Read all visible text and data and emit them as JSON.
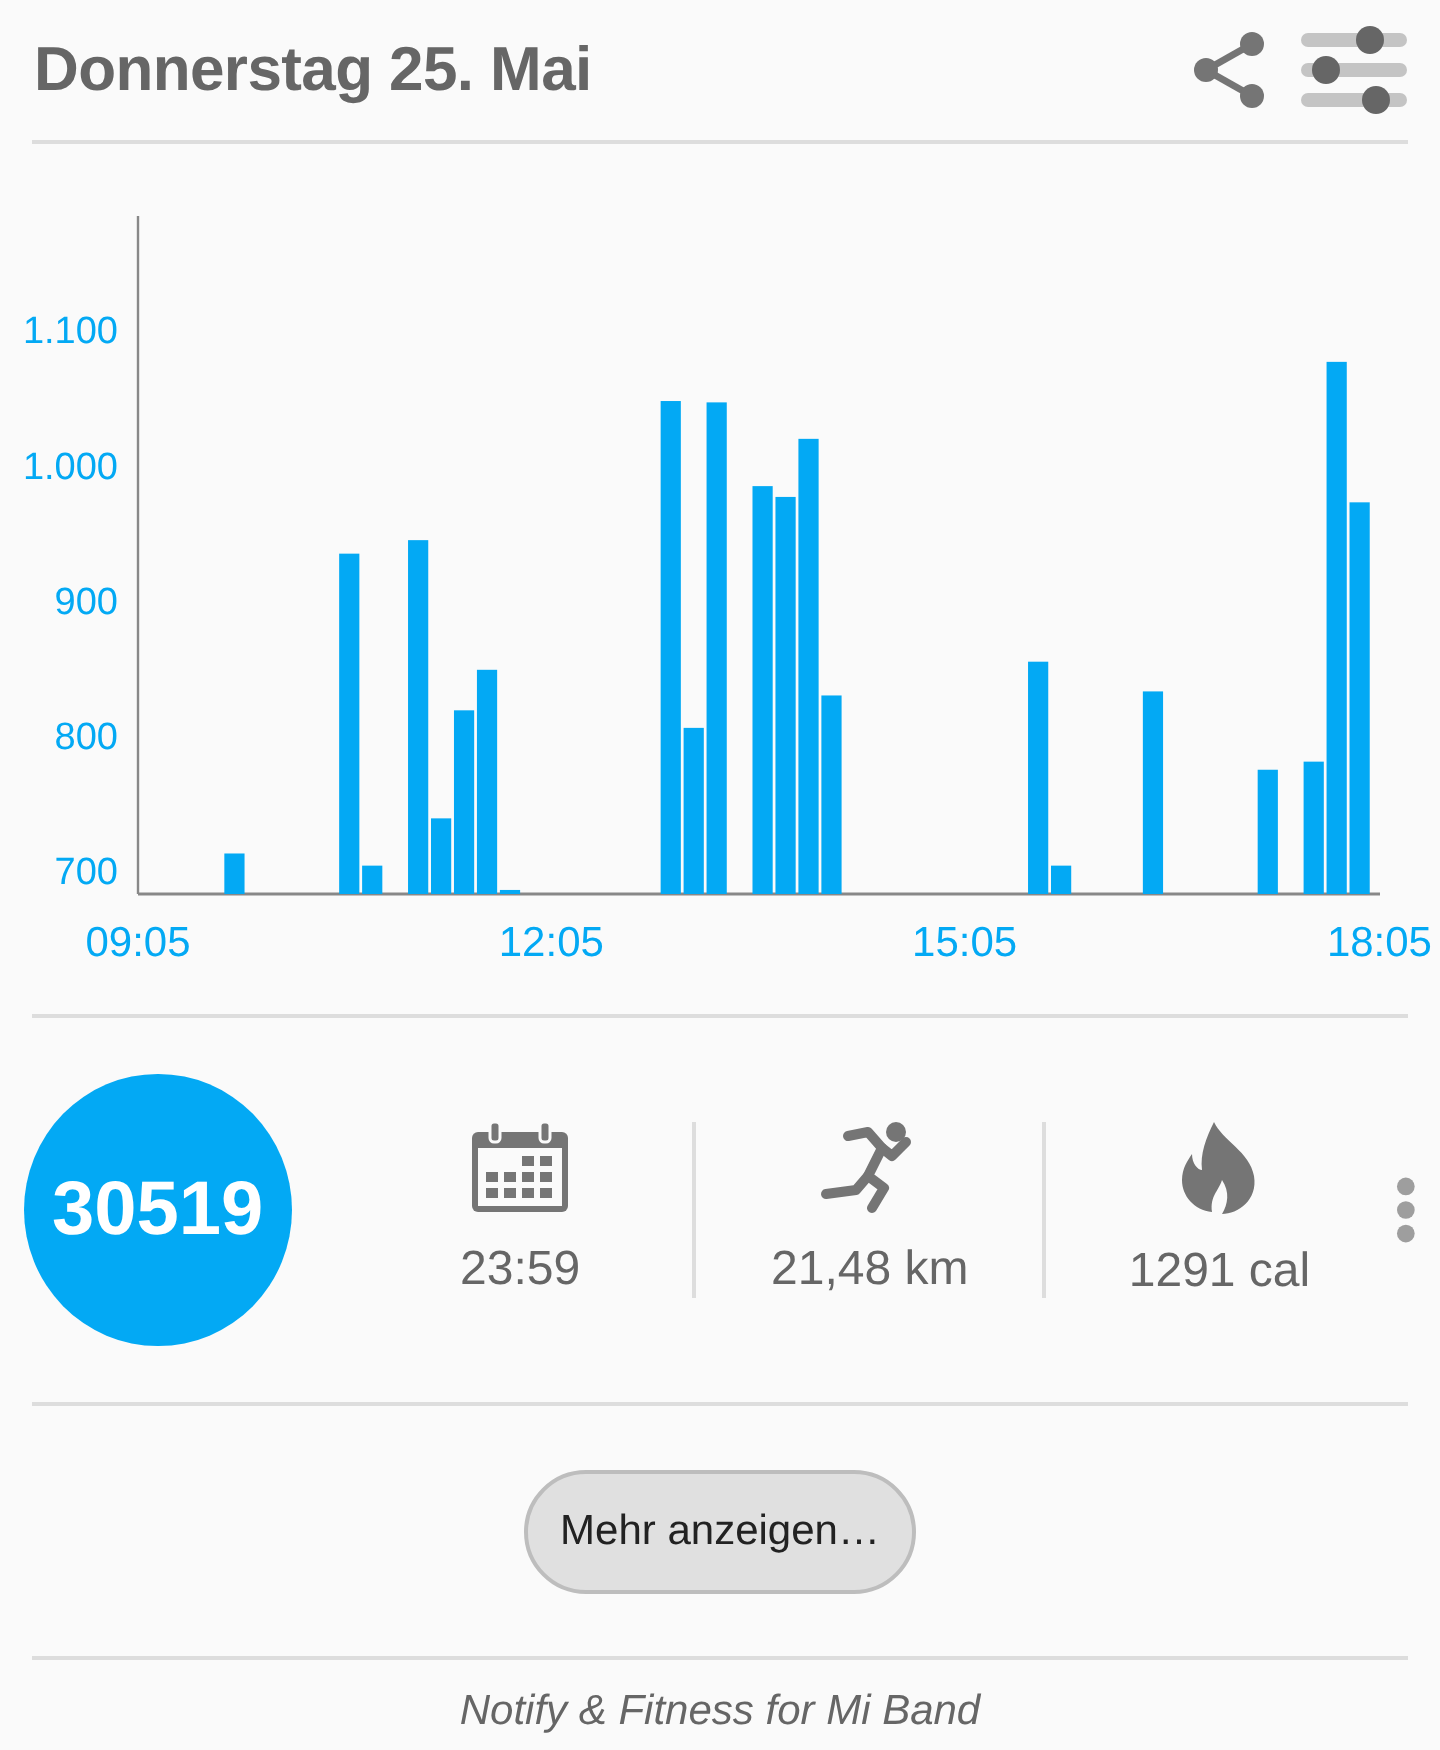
{
  "header": {
    "title": "Donnerstag 25. Mai"
  },
  "chart": {
    "chart_data": {
      "type": "bar",
      "x": [
        587,
        637,
        647,
        667,
        677,
        687,
        697,
        707,
        777,
        787,
        797,
        817,
        827,
        837,
        847,
        937,
        947,
        987,
        1037,
        1057,
        1067,
        1077
      ],
      "series": [
        {
          "color": "#03a9f4",
          "values": [
            712,
            934,
            703,
            944,
            738,
            818,
            848,
            685,
            1047,
            805,
            1046,
            984,
            976,
            1019,
            829,
            854,
            703,
            832,
            774,
            780,
            1076,
            972
          ]
        }
      ],
      "xlim": [
        545,
        1085
      ],
      "ylim": [
        682,
        1184
      ],
      "yticks": [
        700,
        800,
        900,
        {
          "value": 1000,
          "label": "1.000"
        },
        {
          "value": 1100,
          "label": "1.100"
        }
      ],
      "xticks": [
        {
          "value": 545,
          "label": "09:05"
        },
        {
          "value": 725,
          "label": "12:05"
        },
        {
          "value": 905,
          "label": "15:05"
        },
        {
          "value": 1085,
          "label": "18:05"
        }
      ]
    }
  },
  "summary": {
    "steps": "30519",
    "stats": [
      {
        "kind": "calendar",
        "value": "23:59"
      },
      {
        "kind": "running",
        "value": "21,48 km"
      },
      {
        "kind": "flame",
        "value": "1291 cal"
      }
    ]
  },
  "more_button": "Mehr anzeigen…",
  "footer": "Notify & Fitness for Mi Band"
}
